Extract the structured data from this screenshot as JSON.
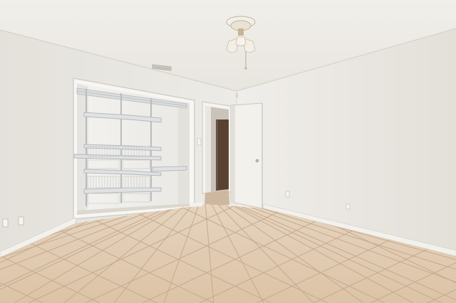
{
  "scene": {
    "kind": "photo",
    "room": "empty bedroom",
    "palette": {
      "ceiling": "#efede8",
      "wall_left": "#e9e7e2",
      "wall_back": "#eeece8",
      "wall_right": "#e7e4df",
      "floor_tile": "#e2cdb4",
      "grout": "#c9b197",
      "baseboard": "#f3f1ec",
      "door": "#f1efea",
      "hall_door": "#5a4233",
      "shelf": "#d8dadb",
      "fixture_glass": "#f4efe6",
      "fixture_brass": "#c8b48d"
    }
  }
}
